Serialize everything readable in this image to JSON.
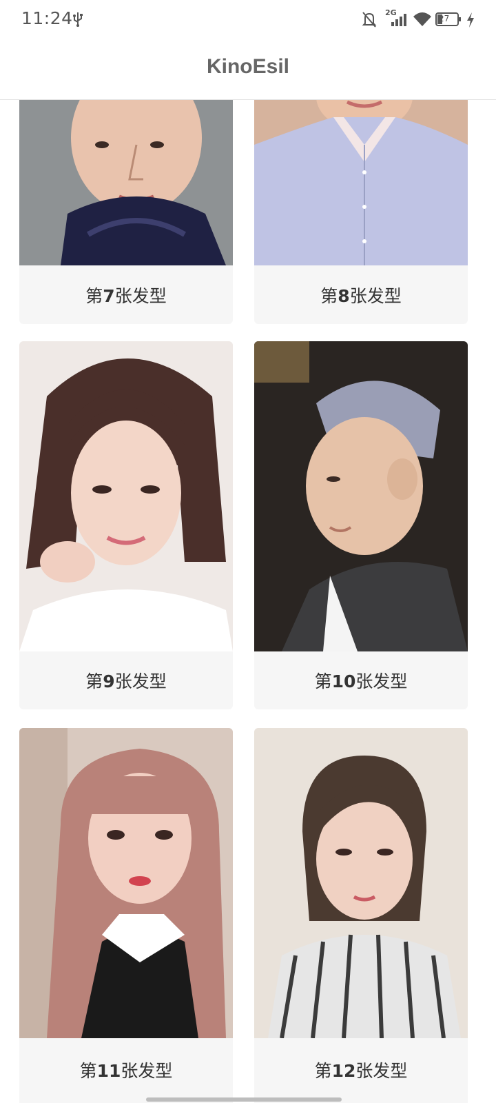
{
  "status_bar": {
    "time": "11:24",
    "network": "2G",
    "battery": "27",
    "icons": [
      "usb-icon",
      "bell-off-icon",
      "signal-icon",
      "wifi-icon",
      "battery-icon",
      "charging-icon"
    ]
  },
  "header": {
    "title": "KinoEsil"
  },
  "cards": [
    {
      "prefix": "第",
      "number": "7",
      "suffix": "张发型"
    },
    {
      "prefix": "第",
      "number": "8",
      "suffix": "张发型"
    },
    {
      "prefix": "第",
      "number": "9",
      "suffix": "张发型"
    },
    {
      "prefix": "第",
      "number": "10",
      "suffix": "张发型"
    },
    {
      "prefix": "第",
      "number": "11",
      "suffix": "张发型"
    },
    {
      "prefix": "第",
      "number": "12",
      "suffix": "张发型"
    }
  ],
  "colors": {
    "card_bg": "#f6f6f6",
    "header_title": "#666666",
    "divider": "#e3e3e3"
  }
}
